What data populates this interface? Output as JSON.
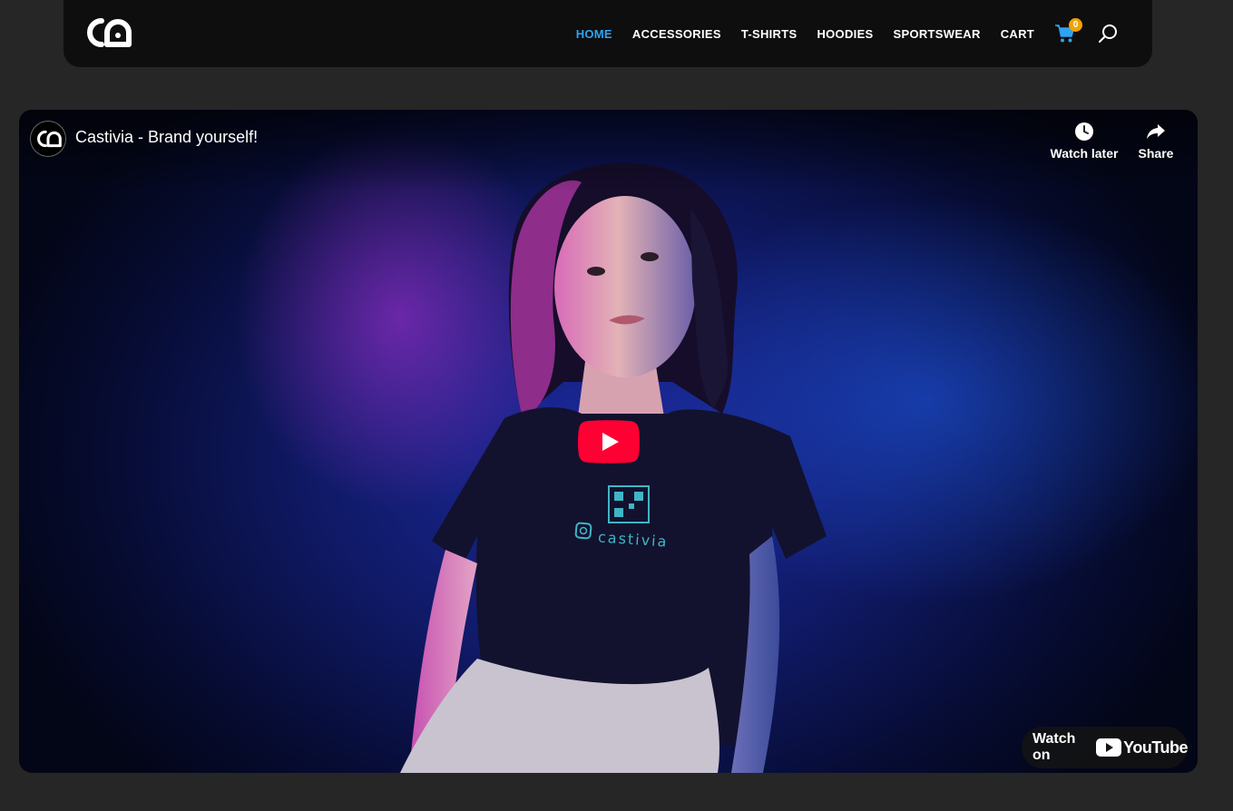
{
  "nav": {
    "items": [
      {
        "label": "HOME",
        "active": true
      },
      {
        "label": "ACCESSORIES",
        "active": false
      },
      {
        "label": "T-SHIRTS",
        "active": false
      },
      {
        "label": "HOODIES",
        "active": false
      },
      {
        "label": "SPORTSWEAR",
        "active": false
      },
      {
        "label": "CART",
        "active": false
      }
    ],
    "cart_count": "0",
    "active_color": "#2ea3f2",
    "badge_color": "#f2a200"
  },
  "logo": {
    "icon": "castivia-logo-icon"
  },
  "video": {
    "title": "Castivia - Brand yourself!",
    "actions": {
      "watch_later": "Watch later",
      "share": "Share"
    },
    "watch_on_label": "Watch on",
    "youtube_word": "YouTube",
    "shirt_brand": "castivia",
    "play_color": "#ff0000"
  }
}
